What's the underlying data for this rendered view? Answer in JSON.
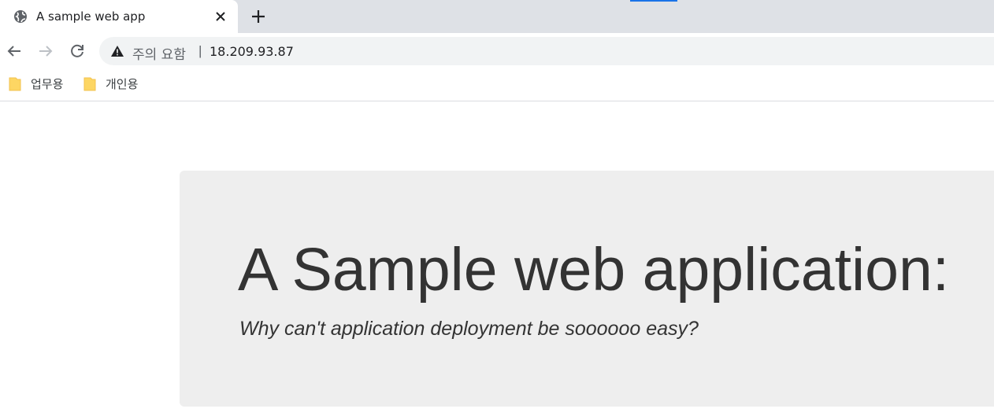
{
  "browser": {
    "tab": {
      "title": "A sample web app",
      "favicon": "globe-icon"
    },
    "address_bar": {
      "security_label": "주의 요함",
      "separator": "|",
      "url": "18.209.93.87"
    },
    "bookmarks": [
      {
        "label": "업무용",
        "icon": "folder-icon"
      },
      {
        "label": "개인용",
        "icon": "folder-icon"
      }
    ]
  },
  "page": {
    "heading": "A Sample web application:",
    "subheading": "Why can't application deployment be soooooo easy?"
  },
  "colors": {
    "tabstrip": "#dee1e6",
    "omnibox": "#f1f3f4",
    "jumbotron": "#eeeeee",
    "text": "#333333",
    "folder": "#fdd663"
  }
}
